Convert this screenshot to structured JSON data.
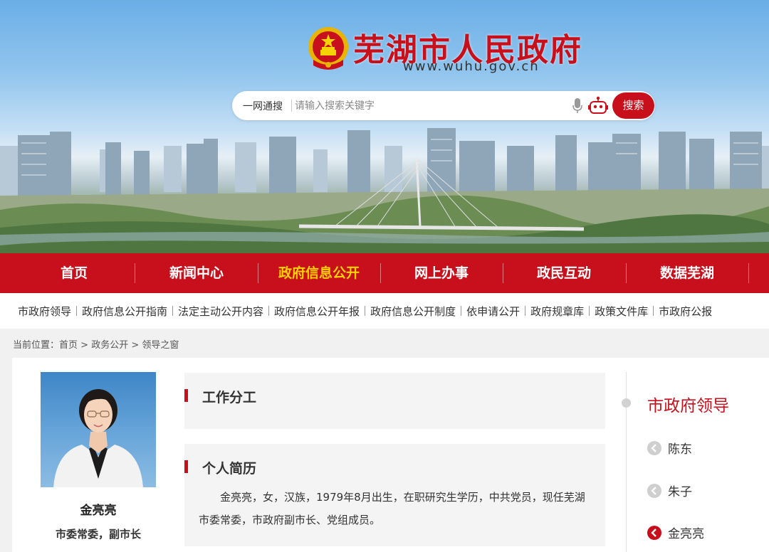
{
  "header": {
    "site_title": "芜湖市人民政府",
    "site_url": "www.wuhu.gov.cn",
    "emblem_icon": "national-emblem-icon"
  },
  "search": {
    "scope_label": "一网通搜",
    "placeholder": "请输入搜索关键字",
    "button_label": "搜索",
    "mic_icon": "microphone-icon",
    "assistant_icon": "robot-icon"
  },
  "main_nav": {
    "items": [
      {
        "label": "首页"
      },
      {
        "label": "新闻中心"
      },
      {
        "label": "政府信息公开",
        "active": true
      },
      {
        "label": "网上办事"
      },
      {
        "label": "政民互动"
      },
      {
        "label": "数据芜湖"
      }
    ],
    "active_color": "#ffd100"
  },
  "sub_nav": {
    "items": [
      "市政府领导",
      "政府信息公开指南",
      "法定主动公开内容",
      "政府信息公开年报",
      "政府信息公开制度",
      "依申请公开",
      "政府规章库",
      "政策文件库",
      "市政府公报"
    ]
  },
  "breadcrumb": {
    "label": "当前位置：",
    "items": [
      "首页",
      "政务公开",
      "领导之窗"
    ],
    "separator": ">"
  },
  "profile": {
    "name": "金亮亮",
    "title": "市委常委，副市长"
  },
  "sections": {
    "duties_title": "工作分工",
    "bio_title": "个人简历",
    "bio_text": "金亮亮，女，汉族，1979年8月出生，在职研究生学历，中共党员，现任芜湖市委常委，市政府副市长、党组成员。"
  },
  "sidebar": {
    "title": "市政府领导",
    "items": [
      {
        "label": "陈东",
        "active": false
      },
      {
        "label": "朱子",
        "active": false
      },
      {
        "label": "金亮亮",
        "active": true
      }
    ]
  },
  "colors": {
    "brand_red": "#c8101d"
  }
}
